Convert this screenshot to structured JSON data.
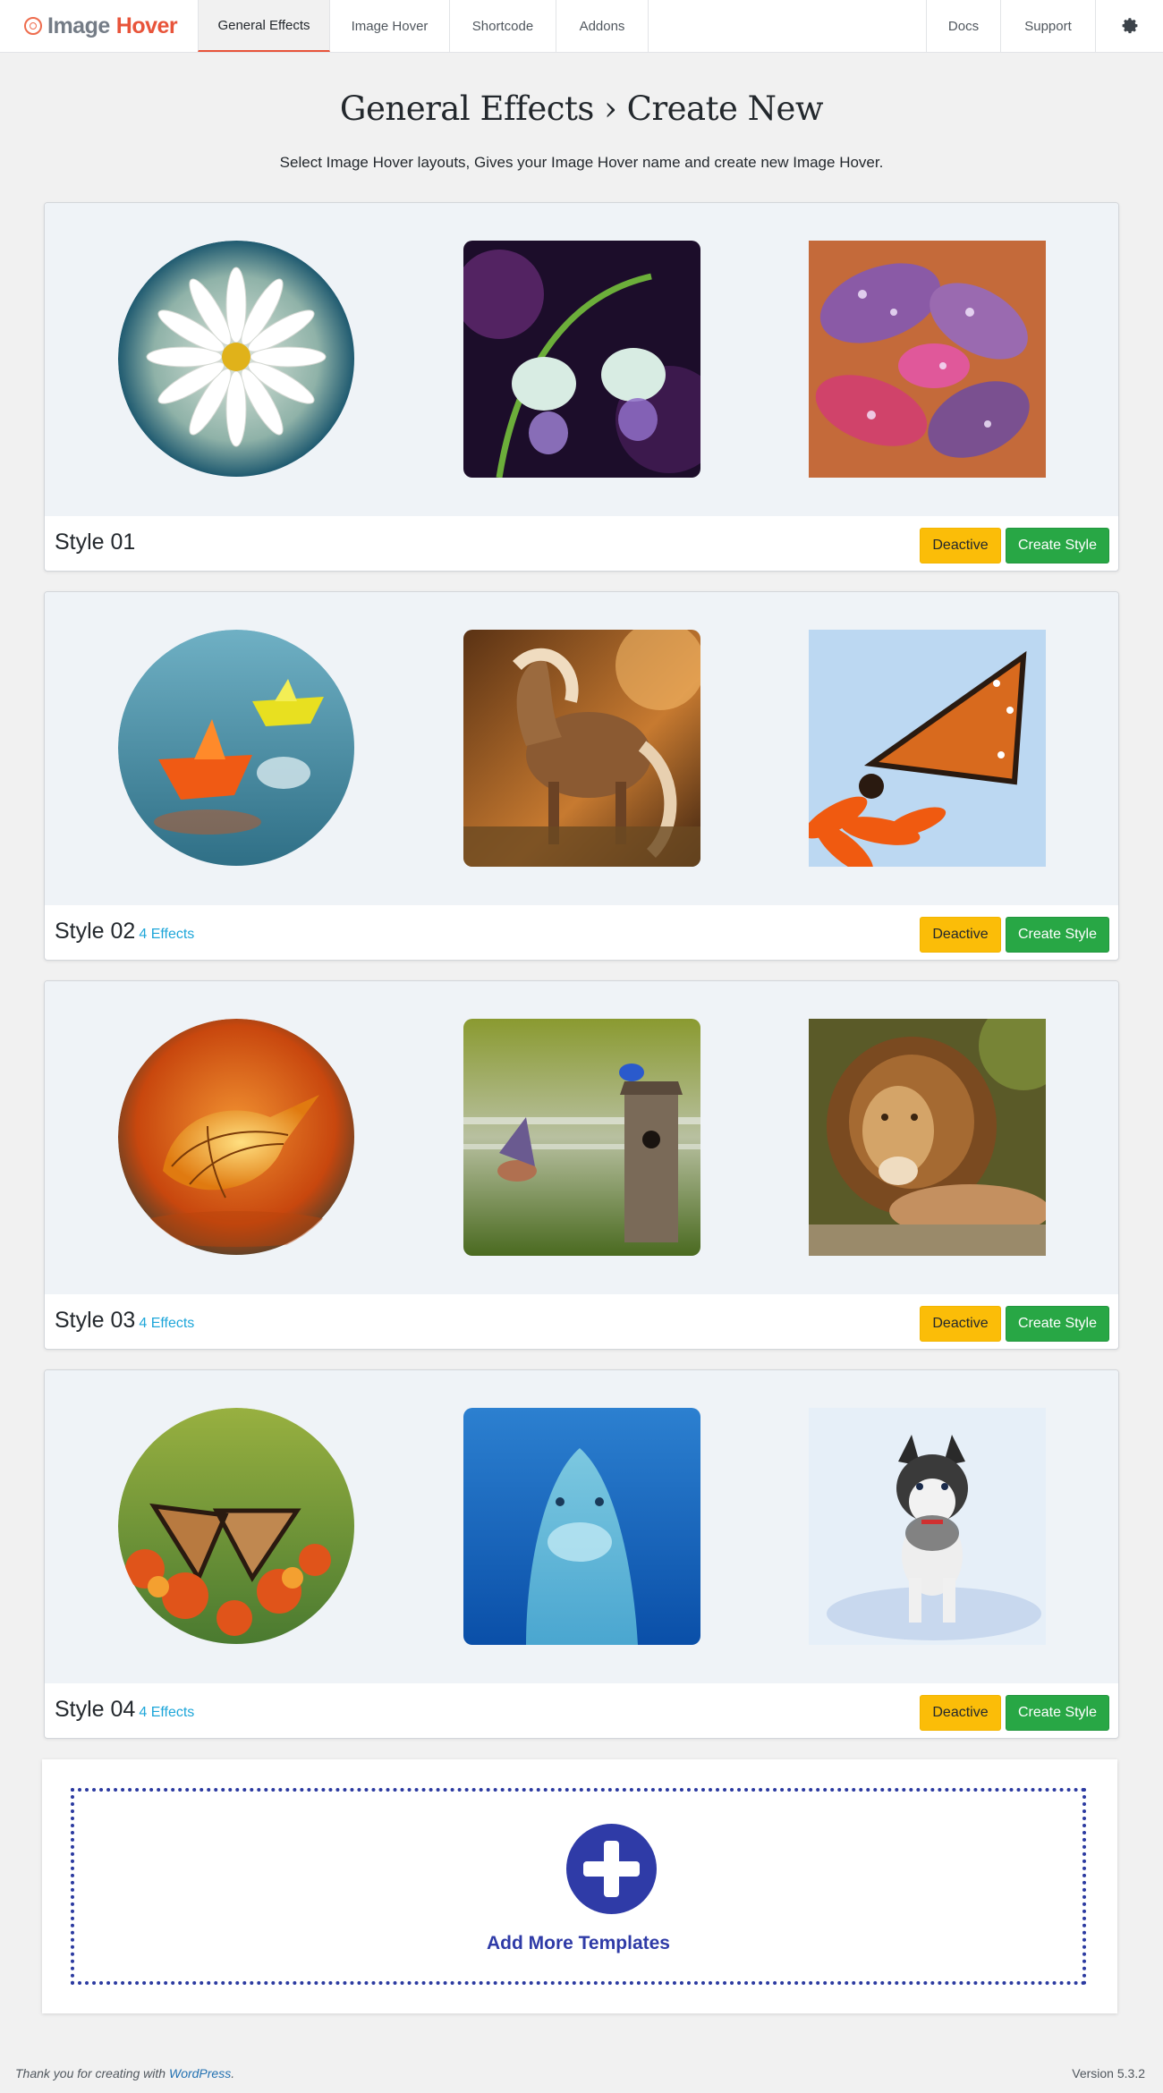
{
  "brand": {
    "part1": "Image",
    "part2": "Hover"
  },
  "nav": {
    "tabs": [
      "General Effects",
      "Image Hover",
      "Shortcode",
      "Addons"
    ],
    "right": [
      "Docs",
      "Support"
    ],
    "settings_icon": "gear-icon"
  },
  "header": {
    "title": "General Effects › Create New",
    "subtitle": "Select Image Hover layouts, Gives your Image Hover name and create new Image Hover."
  },
  "styles": [
    {
      "name": "Style 01",
      "effects": "",
      "deactive": "Deactive",
      "create": "Create Style",
      "images": [
        "daisy",
        "water-drop-flowers",
        "wet-leaves"
      ]
    },
    {
      "name": "Style 02",
      "effects": "4 Effects",
      "deactive": "Deactive",
      "create": "Create Style",
      "images": [
        "paper-boats",
        "horse",
        "butterfly-on-flower"
      ]
    },
    {
      "name": "Style 03",
      "effects": "4 Effects",
      "deactive": "Deactive",
      "create": "Create Style",
      "images": [
        "glowing-physalis",
        "bluebirds-birdhouse",
        "lion"
      ]
    },
    {
      "name": "Style 04",
      "effects": "4 Effects",
      "deactive": "Deactive",
      "create": "Create Style",
      "images": [
        "monarch-butterfly",
        "dolphin",
        "husky-puppy"
      ]
    }
  ],
  "add_more": {
    "label": "Add More Templates",
    "icon": "plus-icon"
  },
  "footer": {
    "thanks_prefix": "Thank you for creating with ",
    "thanks_link": "WordPress",
    "thanks_suffix": ".",
    "version": "Version 5.3.2"
  },
  "colors": {
    "brand_accent": "#e8543a",
    "deactive": "#fbbd08",
    "create": "#28a745",
    "effects_link": "#1ea6d9",
    "add_more": "#2f3ba7"
  }
}
